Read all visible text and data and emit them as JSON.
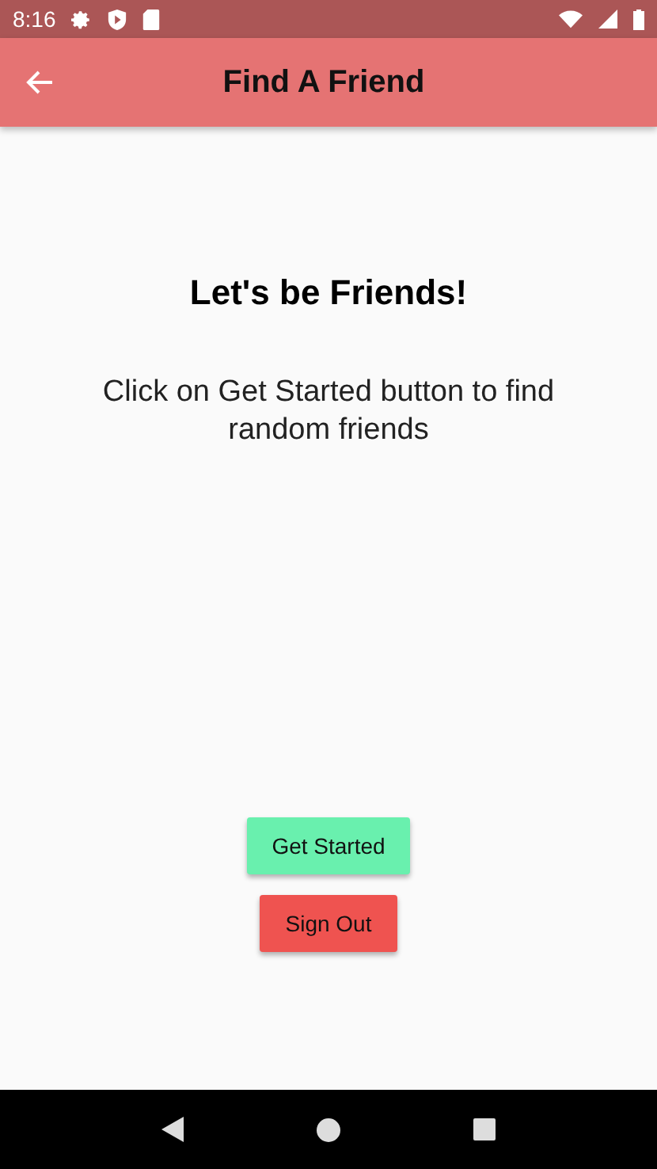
{
  "status_bar": {
    "time": "8:16"
  },
  "app_bar": {
    "title": "Find A Friend"
  },
  "heading": "Let's be Friends!",
  "message": "Click on Get Started button to find random friends",
  "buttons": [
    {
      "label": "Get Started",
      "color": "#69f0ae"
    },
    {
      "label": "Sign Out",
      "color": "#ef5350"
    }
  ]
}
